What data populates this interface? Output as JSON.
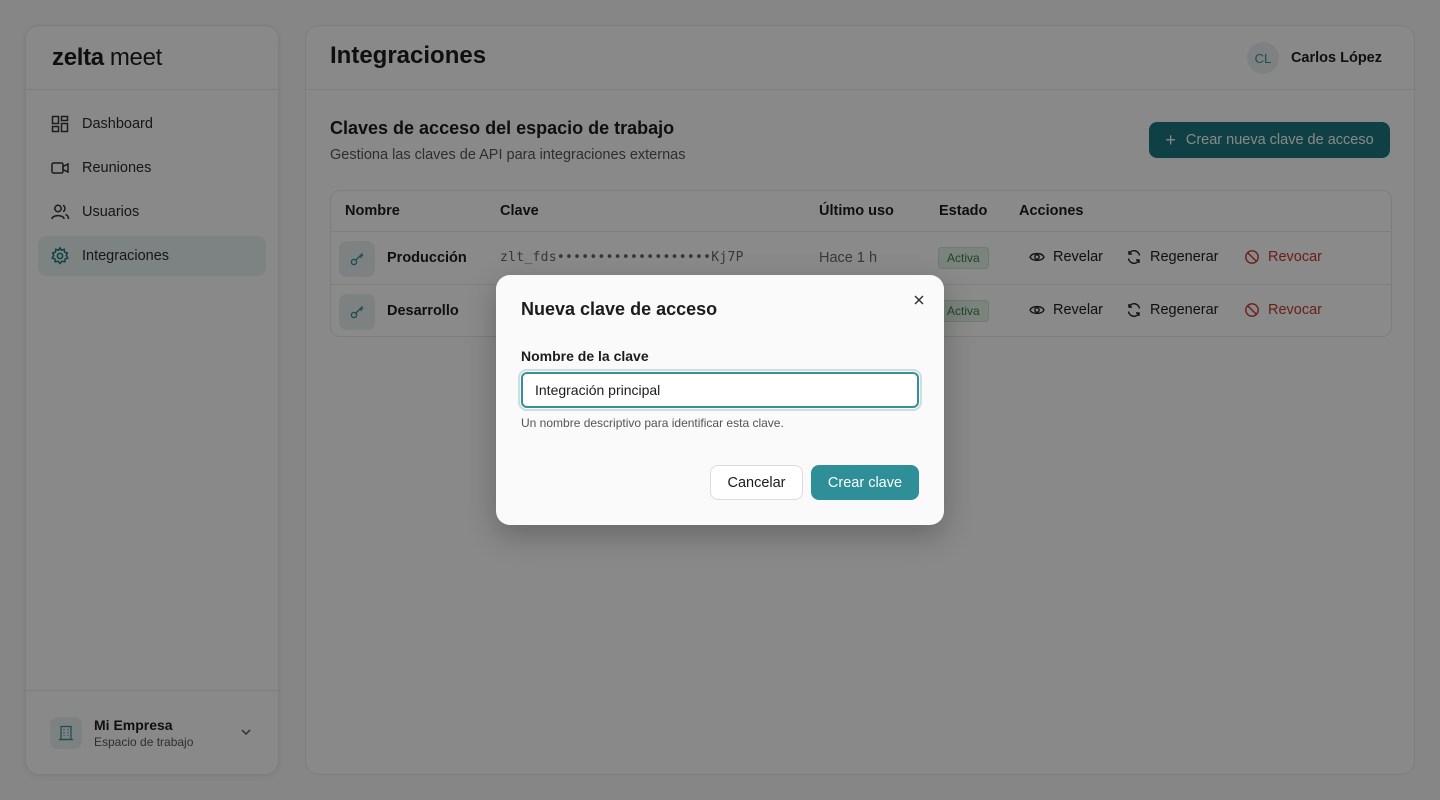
{
  "brand": {
    "part1": "zelta",
    "part2": "meet"
  },
  "sidebar": {
    "items": [
      {
        "label": "Dashboard",
        "icon": "dashboard-icon"
      },
      {
        "label": "Reuniones",
        "icon": "video-icon"
      },
      {
        "label": "Usuarios",
        "icon": "users-icon"
      },
      {
        "label": "Integraciones",
        "icon": "gear-icon",
        "active": true
      }
    ],
    "workspace": {
      "name": "Mi Empresa",
      "subtitle": "Espacio de trabajo",
      "icon": "building-icon"
    }
  },
  "header": {
    "title": "Integraciones",
    "user": {
      "initials": "CL",
      "name": "Carlos López"
    }
  },
  "section": {
    "title": "Claves de acceso del espacio de trabajo",
    "subtitle": "Gestiona las claves de API para integraciones externas",
    "create_label": "Crear nueva clave de acceso"
  },
  "table": {
    "columns": [
      "Nombre",
      "Clave",
      "Último uso",
      "Estado",
      "Acciones"
    ],
    "rows": [
      {
        "name": "Producción",
        "key": "zlt_fds•••••••••••••••••••Kj7P",
        "last_used": "Hace 1 h",
        "status": "Activa"
      },
      {
        "name": "Desarrollo",
        "key": "",
        "last_used": "",
        "status": "Activa"
      }
    ],
    "actions": {
      "reveal": "Revelar",
      "regenerate": "Regenerar",
      "revoke": "Revocar"
    }
  },
  "modal": {
    "title": "Nueva clave de acceso",
    "field_label": "Nombre de la clave",
    "field_value": "Integración principal",
    "field_help": "Un nombre descriptivo para identificar esta clave.",
    "cancel_label": "Cancelar",
    "create_label": "Crear clave"
  },
  "colors": {
    "accent": "#1d7680",
    "accent_button": "#2e8f98",
    "danger": "#c0392b",
    "success": "#3b7a46"
  }
}
